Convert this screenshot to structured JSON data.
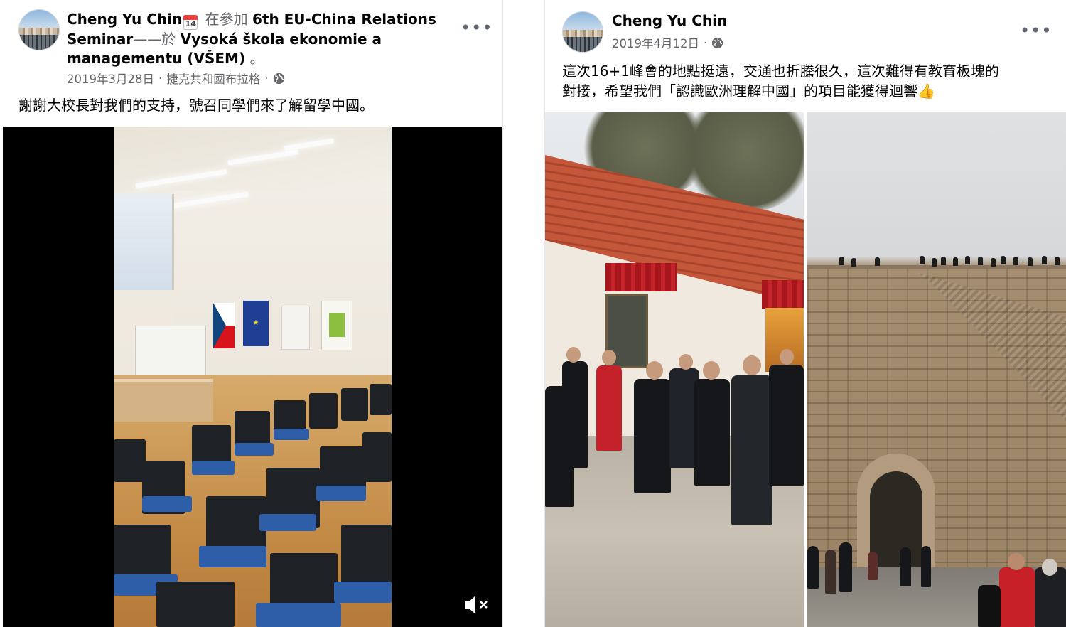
{
  "left_post": {
    "author": "Cheng Yu Chin",
    "calendar_day": "14",
    "header_pre_event": " 在參加 ",
    "event": "6th EU-China Relations Seminar",
    "header_connector": "——於 ",
    "place": "Vysoká škola ekonomie a managementu (VŠEM)",
    "header_end": " 。",
    "date": "2019年3月28日",
    "separator": "·",
    "location": "捷克共和國布拉格",
    "text": "謝謝大校長對我們的支持，號召同學們來了解留學中國。",
    "more_label": "•••",
    "privacy_icon": "globe-icon",
    "media_type": "video",
    "mute_icon": "muted-speaker-icon"
  },
  "right_post": {
    "author": "Cheng Yu Chin",
    "date": "2019年4月12日",
    "separator": "·",
    "text_line1": "這次16+1峰會的地點挺遠，交通也折騰很久，這次難得有教育板塊的",
    "text_line2": "對接，希望我們「認識歐洲理解中國」的項目能獲得迴響",
    "emoji": "👍",
    "more_label": "•••",
    "privacy_icon": "globe-icon",
    "media_type": "photos",
    "photo_count": 2
  },
  "colors": {
    "text_primary": "#050505",
    "text_secondary": "#65676b",
    "divider": "#e4e6eb",
    "video_background": "#000000"
  }
}
